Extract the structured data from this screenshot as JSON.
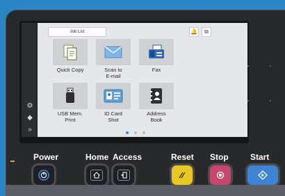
{
  "screen": {
    "job_list_label": "Job List",
    "tiles": [
      {
        "label": "Quick Copy",
        "icon": "copy-icon"
      },
      {
        "label": "Scan to E-mail",
        "icon": "envelope-icon"
      },
      {
        "label": "Fax",
        "icon": "fax-icon"
      },
      {
        "label": "USB Mem. Print",
        "icon": "usb-icon"
      },
      {
        "label": "ID Card Shot",
        "icon": "id-card-icon"
      },
      {
        "label": "Address Book",
        "icon": "address-book-icon"
      }
    ],
    "tile_labels": {
      "quick_copy": "Quick Copy",
      "scan_line1": "Scan to",
      "scan_line2": "E-mail",
      "fax": "Fax",
      "usb_line1": "USB Mem.",
      "usb_line2": "Print",
      "id_line1": "ID Card",
      "id_line2": "Shot",
      "addr_line1": "Address",
      "addr_line2": "Book"
    },
    "page_indicator": {
      "current": 1,
      "total": 3
    }
  },
  "panel": {
    "power_label": "Power",
    "home_label": "Home",
    "access_label": "Access",
    "reset_label": "Reset",
    "stop_label": "Stop",
    "start_label": "Start"
  },
  "colors": {
    "reset": "#e9c81f",
    "stop": "#c8466b",
    "start": "#3d84d6",
    "power_ring": "#3b6fc2",
    "accent_blue": "#2a86c4"
  }
}
